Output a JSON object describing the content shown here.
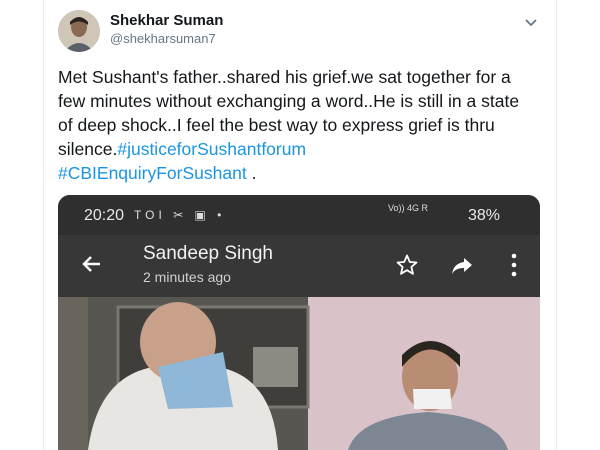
{
  "tweet": {
    "author_name": "Shekhar Suman",
    "author_handle": "@shekharsuman7",
    "text_plain": "Met Sushant's father..shared his grief.we sat together for a few minutes without exchanging a word..He is still in a state of deep shock..I feel the best way to express grief is thru silence.",
    "hashtag_1": "#justiceforSushantforum",
    "hashtag_2": "#CBIEnquiryForSushant",
    "text_tail": " .",
    "link_color": "#1b95e0"
  },
  "phone": {
    "time": "20:20",
    "status_icons": "TOI ✂ ▣ •",
    "network": "Vo)) 4G R",
    "battery": "38%",
    "sender": "Sandeep Singh",
    "ago": "2 minutes ago",
    "icons": [
      "back-arrow-icon",
      "star-icon",
      "share-icon",
      "more-vert-icon"
    ]
  }
}
